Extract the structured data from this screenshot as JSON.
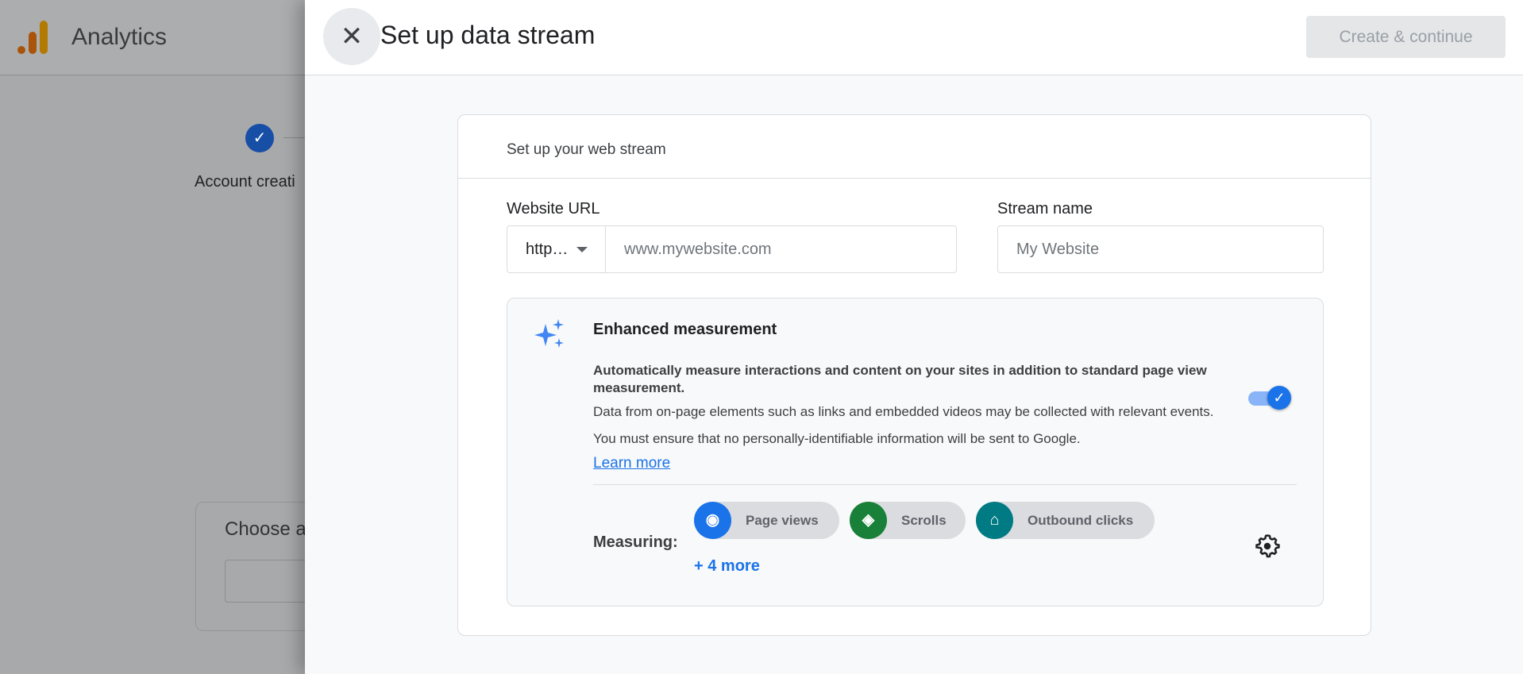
{
  "background": {
    "app_name": "Analytics",
    "step_label": "Account creati",
    "choose_label": "Choose a"
  },
  "panel": {
    "title": "Set up data stream",
    "create_button": "Create & continue"
  },
  "card": {
    "title": "Set up your web stream",
    "website_url_label": "Website URL",
    "protocol_value": "http…",
    "url_placeholder": "www.mywebsite.com",
    "stream_name_label": "Stream name",
    "stream_name_placeholder": "My Website"
  },
  "enhanced": {
    "title": "Enhanced measurement",
    "bold_desc": "Automatically measure interactions and content on your sites in addition to standard page view measurement.",
    "desc": "Data from on-page elements such as links and embedded videos may be collected with relevant events. You must ensure that no personally-identifiable information will be sent to Google.",
    "learn_more": "Learn more",
    "enabled": true,
    "measuring_label": "Measuring:",
    "chips": [
      {
        "label": "Page views",
        "icon": "eye-icon",
        "color": "#1a73e8"
      },
      {
        "label": "Scrolls",
        "icon": "scroll-icon",
        "color": "#188038"
      },
      {
        "label": "Outbound clicks",
        "icon": "mouse-icon",
        "color": "#007b83"
      }
    ],
    "more": "+ 4 more"
  }
}
